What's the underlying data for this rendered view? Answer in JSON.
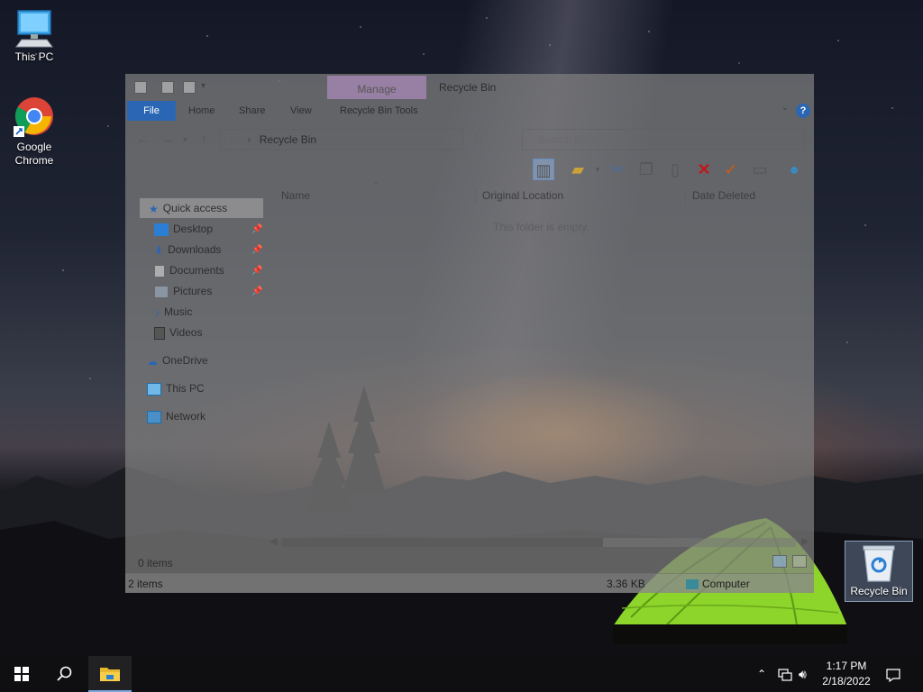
{
  "desktop": {
    "icons": [
      {
        "label": "This PC",
        "icon": "monitor-icon"
      },
      {
        "label": "Google Chrome",
        "icon": "chrome-icon"
      },
      {
        "label": "Recycle Bin",
        "icon": "recycle-bin-icon"
      }
    ]
  },
  "explorer": {
    "title": "Recycle Bin",
    "contextual_tab": "Manage",
    "tabs": [
      "File",
      "Home",
      "Share",
      "View",
      "Recycle Bin Tools"
    ],
    "address": "Recycle Bin",
    "search_placeholder": "Search Recycle Bin",
    "columns": [
      "Name",
      "Original Location",
      "Date Deleted"
    ],
    "empty_message": "This folder is empty.",
    "nav": {
      "quick_access": "Quick access",
      "items": [
        "Desktop",
        "Downloads",
        "Documents",
        "Pictures",
        "Music",
        "Videos"
      ],
      "onedrive": "OneDrive",
      "this_pc": "This PC",
      "network": "Network"
    },
    "status_items": "0 items",
    "status_bar": {
      "items": "2 items",
      "size": "3.36 KB",
      "location": "Computer"
    }
  },
  "taskbar": {
    "time": "1:17 PM",
    "date": "2/18/2022"
  },
  "colors": {
    "accent": "#2a66b4",
    "manage_tab": "#af8cbe",
    "taskbar": "#0f0f12",
    "tent_green": "#9bea2e"
  }
}
